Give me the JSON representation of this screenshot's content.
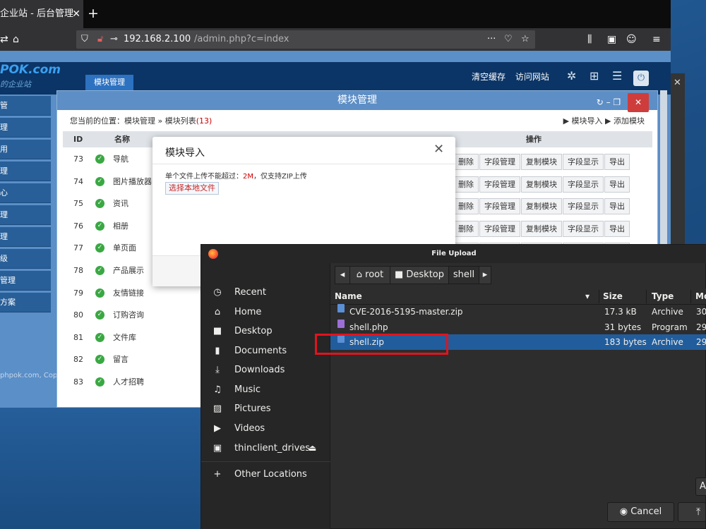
{
  "browser": {
    "tab_title": "企业站 - 后台管理",
    "tab_close": "✕",
    "new_tab": "+",
    "url_host": "192.168.2.100",
    "url_path": "/admin.php?c=index",
    "url_more": "···"
  },
  "admin": {
    "brand": "POK.com",
    "brand_sub": "的企业站",
    "active_tab": "模块管理",
    "header_links": [
      "清空缓存",
      "访问网站"
    ],
    "sidebar_items": [
      "管",
      "理",
      "用",
      "理",
      "心",
      "理",
      "理",
      "级",
      "管理",
      "方案"
    ],
    "copyright": "phpok.com, Copy",
    "panel_title": "模块管理",
    "breadcrumb_prefix": "您当前的位置：",
    "breadcrumb_path": "模块管理 » 模块列表",
    "breadcrumb_count": "(13)",
    "action_import": "▶ 模块导入",
    "action_add": "▶ 添加模块",
    "columns": {
      "id": "ID",
      "name": "名称",
      "ops": "操作"
    },
    "rows": [
      {
        "id": "73",
        "name": "导航"
      },
      {
        "id": "74",
        "name": "图片播放器"
      },
      {
        "id": "75",
        "name": "资讯"
      },
      {
        "id": "76",
        "name": "相册"
      },
      {
        "id": "77",
        "name": "单页面"
      },
      {
        "id": "78",
        "name": "产品展示"
      },
      {
        "id": "79",
        "name": "友情链接"
      },
      {
        "id": "80",
        "name": "订购咨询"
      },
      {
        "id": "81",
        "name": "文件库"
      },
      {
        "id": "82",
        "name": "留言"
      },
      {
        "id": "83",
        "name": "人才招聘"
      }
    ],
    "row_ops": [
      "删除",
      "字段管理",
      "复制模块",
      "字段显示",
      "导出"
    ],
    "row_ops_partial": [
      "删除",
      "字段管理",
      "复制模块",
      "字段显示",
      "导出"
    ]
  },
  "import_modal": {
    "title": "模块导入",
    "close": "✕",
    "note_prefix": "单个文件上传不能超过：",
    "note_limit": "2M",
    "note_suffix": "，仅支持ZIP上传",
    "choose_button": "选择本地文件"
  },
  "file_chooser": {
    "title": "File Upload",
    "places": [
      {
        "label": "Recent",
        "icon": "clock-icon"
      },
      {
        "label": "Home",
        "icon": "home-icon"
      },
      {
        "label": "Desktop",
        "icon": "desktop-icon"
      },
      {
        "label": "Documents",
        "icon": "document-icon"
      },
      {
        "label": "Downloads",
        "icon": "download-icon"
      },
      {
        "label": "Music",
        "icon": "music-icon"
      },
      {
        "label": "Pictures",
        "icon": "picture-icon"
      },
      {
        "label": "Videos",
        "icon": "video-icon"
      },
      {
        "label": "thinclient_drives",
        "icon": "drive-icon"
      },
      {
        "label": "Other Locations",
        "icon": "plus-icon"
      }
    ],
    "path": [
      "root",
      "Desktop",
      "shell"
    ],
    "columns": {
      "name": "Name",
      "size": "Size",
      "type": "Type",
      "modified": "Mo"
    },
    "files": [
      {
        "name": "CVE-2016-5195-master.zip",
        "size": "17.3 kB",
        "type": "Archive",
        "modified": "30",
        "icon_color": "#5b8fd6"
      },
      {
        "name": "shell.php",
        "size": "31 bytes",
        "type": "Program",
        "modified": "29",
        "icon_color": "#9c6fd6"
      },
      {
        "name": "shell.zip",
        "size": "183 bytes",
        "type": "Archive",
        "modified": "29",
        "icon_color": "#5b8fd6",
        "selected": true
      }
    ],
    "cancel": "Cancel",
    "partial_button": "A"
  }
}
